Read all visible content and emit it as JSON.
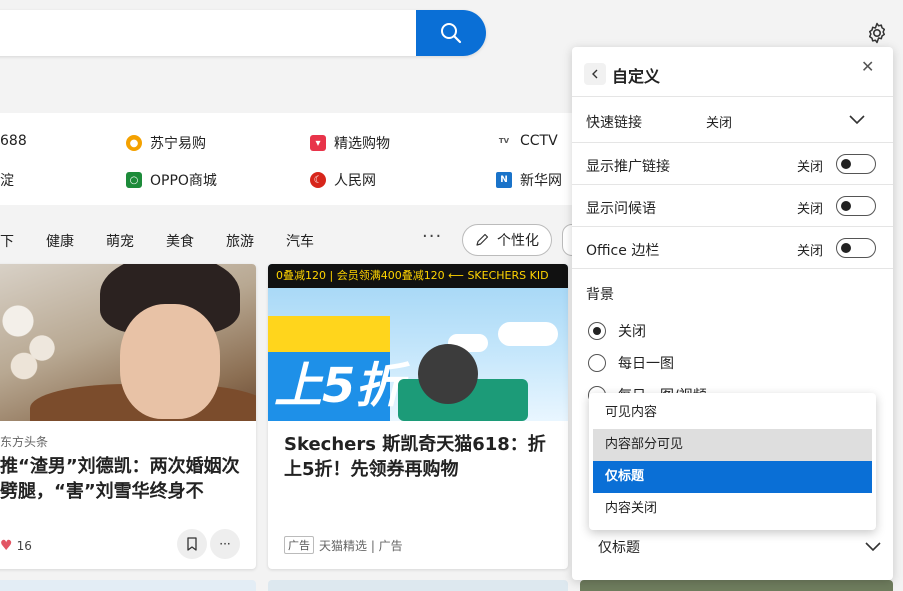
{
  "colors": {
    "accent": "#0a6fd6",
    "panel_bg": "#ffffff",
    "page_bg": "#f3f3f3"
  },
  "quick_links": [
    {
      "label": "688",
      "icon": "partial-link-icon"
    },
    {
      "label": "苏宁易购",
      "icon": "suning-icon"
    },
    {
      "label": "精选购物",
      "icon": "shopping-bag-icon"
    },
    {
      "label": "CCTV",
      "icon": "cctv-icon"
    },
    {
      "label": "淀",
      "icon": "partial-link-icon"
    },
    {
      "label": "OPPO商城",
      "icon": "oppo-icon"
    },
    {
      "label": "人民网",
      "icon": "people-daily-icon"
    },
    {
      "label": "新华网",
      "icon": "xinhua-icon"
    }
  ],
  "categories": [
    "下",
    "健康",
    "萌宠",
    "美食",
    "旅游",
    "汽车"
  ],
  "personalize_label": "个性化",
  "cards": {
    "card1": {
      "source": "东方头条",
      "title": "推“渣男”刘德凯：两次婚姻次劈腿，“害”刘雪华终身不",
      "likes": "16"
    },
    "card2": {
      "banner": "0叠减120 | 会员领满400叠减120  ⟵  SKECHERS KID",
      "big_text": "上5折",
      "title": "Skechers 斯凯奇天猫618：折上5折！先领券再购物",
      "ad_tag": "广告",
      "ad_source": "天猫精选 | 广告"
    }
  },
  "panel": {
    "title": "自定义",
    "rows": {
      "quick_links": {
        "label": "快速链接",
        "state": "关闭"
      },
      "promo_links": {
        "label": "显示推广链接",
        "state": "关闭"
      },
      "greeting": {
        "label": "显示问候语",
        "state": "关闭"
      },
      "office": {
        "label": "Office 边栏",
        "state": "关闭"
      }
    },
    "background": {
      "label": "背景",
      "options": [
        "关闭",
        "每日一图",
        "每日一图/视频"
      ],
      "selected": "关闭"
    },
    "content_dropdown_value": "仅标题"
  },
  "menu": {
    "items": [
      "可见内容",
      "内容部分可见",
      "仅标题",
      "内容关闭"
    ],
    "selected": "仅标题",
    "hovered": "内容部分可见"
  }
}
